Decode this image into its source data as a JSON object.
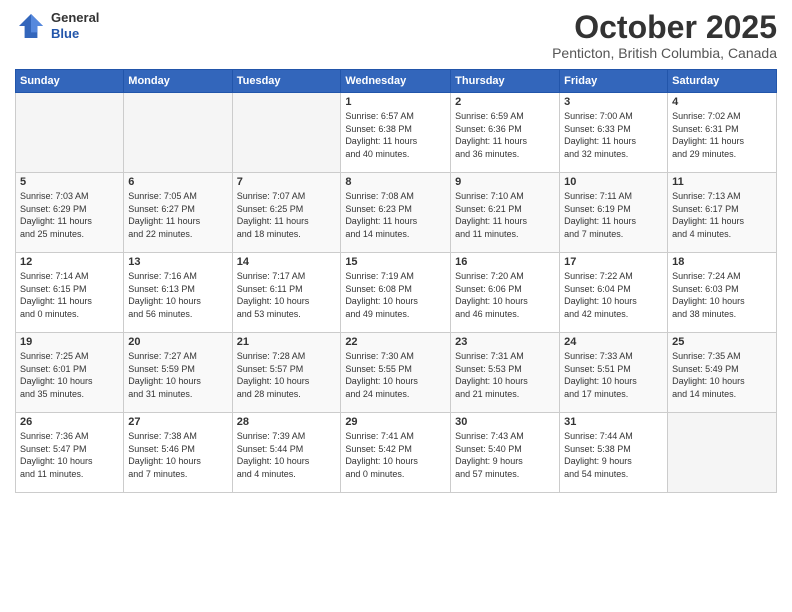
{
  "header": {
    "logo_line1": "General",
    "logo_line2": "Blue",
    "month_title": "October 2025",
    "location": "Penticton, British Columbia, Canada"
  },
  "weekdays": [
    "Sunday",
    "Monday",
    "Tuesday",
    "Wednesday",
    "Thursday",
    "Friday",
    "Saturday"
  ],
  "weeks": [
    [
      {
        "day": "",
        "info": ""
      },
      {
        "day": "",
        "info": ""
      },
      {
        "day": "",
        "info": ""
      },
      {
        "day": "1",
        "info": "Sunrise: 6:57 AM\nSunset: 6:38 PM\nDaylight: 11 hours\nand 40 minutes."
      },
      {
        "day": "2",
        "info": "Sunrise: 6:59 AM\nSunset: 6:36 PM\nDaylight: 11 hours\nand 36 minutes."
      },
      {
        "day": "3",
        "info": "Sunrise: 7:00 AM\nSunset: 6:33 PM\nDaylight: 11 hours\nand 32 minutes."
      },
      {
        "day": "4",
        "info": "Sunrise: 7:02 AM\nSunset: 6:31 PM\nDaylight: 11 hours\nand 29 minutes."
      }
    ],
    [
      {
        "day": "5",
        "info": "Sunrise: 7:03 AM\nSunset: 6:29 PM\nDaylight: 11 hours\nand 25 minutes."
      },
      {
        "day": "6",
        "info": "Sunrise: 7:05 AM\nSunset: 6:27 PM\nDaylight: 11 hours\nand 22 minutes."
      },
      {
        "day": "7",
        "info": "Sunrise: 7:07 AM\nSunset: 6:25 PM\nDaylight: 11 hours\nand 18 minutes."
      },
      {
        "day": "8",
        "info": "Sunrise: 7:08 AM\nSunset: 6:23 PM\nDaylight: 11 hours\nand 14 minutes."
      },
      {
        "day": "9",
        "info": "Sunrise: 7:10 AM\nSunset: 6:21 PM\nDaylight: 11 hours\nand 11 minutes."
      },
      {
        "day": "10",
        "info": "Sunrise: 7:11 AM\nSunset: 6:19 PM\nDaylight: 11 hours\nand 7 minutes."
      },
      {
        "day": "11",
        "info": "Sunrise: 7:13 AM\nSunset: 6:17 PM\nDaylight: 11 hours\nand 4 minutes."
      }
    ],
    [
      {
        "day": "12",
        "info": "Sunrise: 7:14 AM\nSunset: 6:15 PM\nDaylight: 11 hours\nand 0 minutes."
      },
      {
        "day": "13",
        "info": "Sunrise: 7:16 AM\nSunset: 6:13 PM\nDaylight: 10 hours\nand 56 minutes."
      },
      {
        "day": "14",
        "info": "Sunrise: 7:17 AM\nSunset: 6:11 PM\nDaylight: 10 hours\nand 53 minutes."
      },
      {
        "day": "15",
        "info": "Sunrise: 7:19 AM\nSunset: 6:08 PM\nDaylight: 10 hours\nand 49 minutes."
      },
      {
        "day": "16",
        "info": "Sunrise: 7:20 AM\nSunset: 6:06 PM\nDaylight: 10 hours\nand 46 minutes."
      },
      {
        "day": "17",
        "info": "Sunrise: 7:22 AM\nSunset: 6:04 PM\nDaylight: 10 hours\nand 42 minutes."
      },
      {
        "day": "18",
        "info": "Sunrise: 7:24 AM\nSunset: 6:03 PM\nDaylight: 10 hours\nand 38 minutes."
      }
    ],
    [
      {
        "day": "19",
        "info": "Sunrise: 7:25 AM\nSunset: 6:01 PM\nDaylight: 10 hours\nand 35 minutes."
      },
      {
        "day": "20",
        "info": "Sunrise: 7:27 AM\nSunset: 5:59 PM\nDaylight: 10 hours\nand 31 minutes."
      },
      {
        "day": "21",
        "info": "Sunrise: 7:28 AM\nSunset: 5:57 PM\nDaylight: 10 hours\nand 28 minutes."
      },
      {
        "day": "22",
        "info": "Sunrise: 7:30 AM\nSunset: 5:55 PM\nDaylight: 10 hours\nand 24 minutes."
      },
      {
        "day": "23",
        "info": "Sunrise: 7:31 AM\nSunset: 5:53 PM\nDaylight: 10 hours\nand 21 minutes."
      },
      {
        "day": "24",
        "info": "Sunrise: 7:33 AM\nSunset: 5:51 PM\nDaylight: 10 hours\nand 17 minutes."
      },
      {
        "day": "25",
        "info": "Sunrise: 7:35 AM\nSunset: 5:49 PM\nDaylight: 10 hours\nand 14 minutes."
      }
    ],
    [
      {
        "day": "26",
        "info": "Sunrise: 7:36 AM\nSunset: 5:47 PM\nDaylight: 10 hours\nand 11 minutes."
      },
      {
        "day": "27",
        "info": "Sunrise: 7:38 AM\nSunset: 5:46 PM\nDaylight: 10 hours\nand 7 minutes."
      },
      {
        "day": "28",
        "info": "Sunrise: 7:39 AM\nSunset: 5:44 PM\nDaylight: 10 hours\nand 4 minutes."
      },
      {
        "day": "29",
        "info": "Sunrise: 7:41 AM\nSunset: 5:42 PM\nDaylight: 10 hours\nand 0 minutes."
      },
      {
        "day": "30",
        "info": "Sunrise: 7:43 AM\nSunset: 5:40 PM\nDaylight: 9 hours\nand 57 minutes."
      },
      {
        "day": "31",
        "info": "Sunrise: 7:44 AM\nSunset: 5:38 PM\nDaylight: 9 hours\nand 54 minutes."
      },
      {
        "day": "",
        "info": ""
      }
    ]
  ]
}
